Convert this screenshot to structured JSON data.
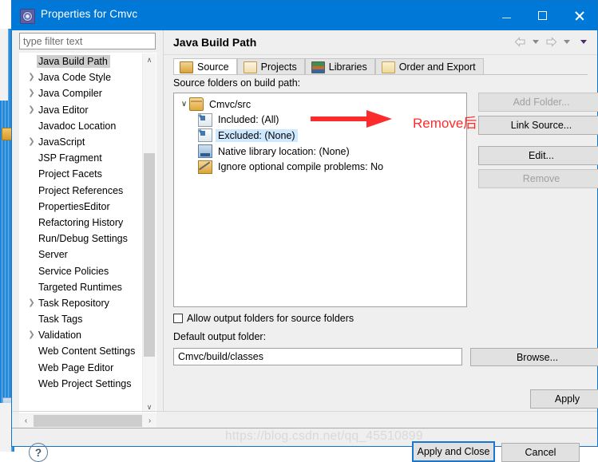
{
  "window": {
    "title": "Properties for Cmvc",
    "icon": "properties-gear-icon",
    "minimize_label": "—",
    "maximize_label": "□",
    "close_label": "✕"
  },
  "sidebar": {
    "filter": {
      "placeholder": "type filter text",
      "value": ""
    },
    "items": [
      {
        "label": "Java Build Path",
        "expandable": false,
        "selected": true
      },
      {
        "label": "Java Code Style",
        "expandable": true,
        "selected": false
      },
      {
        "label": "Java Compiler",
        "expandable": true,
        "selected": false
      },
      {
        "label": "Java Editor",
        "expandable": true,
        "selected": false
      },
      {
        "label": "Javadoc Location",
        "expandable": false,
        "selected": false
      },
      {
        "label": "JavaScript",
        "expandable": true,
        "selected": false
      },
      {
        "label": "JSP Fragment",
        "expandable": false,
        "selected": false
      },
      {
        "label": "Project Facets",
        "expandable": false,
        "selected": false
      },
      {
        "label": "Project References",
        "expandable": false,
        "selected": false
      },
      {
        "label": "PropertiesEditor",
        "expandable": false,
        "selected": false
      },
      {
        "label": "Refactoring History",
        "expandable": false,
        "selected": false
      },
      {
        "label": "Run/Debug Settings",
        "expandable": false,
        "selected": false
      },
      {
        "label": "Server",
        "expandable": false,
        "selected": false
      },
      {
        "label": "Service Policies",
        "expandable": false,
        "selected": false
      },
      {
        "label": "Targeted Runtimes",
        "expandable": false,
        "selected": false
      },
      {
        "label": "Task Repository",
        "expandable": true,
        "selected": false
      },
      {
        "label": "Task Tags",
        "expandable": false,
        "selected": false
      },
      {
        "label": "Validation",
        "expandable": true,
        "selected": false
      },
      {
        "label": "Web Content Settings",
        "expandable": false,
        "selected": false
      },
      {
        "label": "Web Page Editor",
        "expandable": false,
        "selected": false
      },
      {
        "label": "Web Project Settings",
        "expandable": false,
        "selected": false
      }
    ],
    "scroll_up": "∧",
    "scroll_down": "∨",
    "scroll_left": "‹",
    "scroll_right": "›"
  },
  "page": {
    "title": "Java Build Path",
    "nav_back": "back-arrow",
    "nav_forward": "forward-arrow",
    "nav_menu": "view-menu"
  },
  "tabs": [
    {
      "label": "Source",
      "icon": "source-folder-icon",
      "active": true
    },
    {
      "label": "Projects",
      "icon": "projects-folder-icon",
      "active": false
    },
    {
      "label": "Libraries",
      "icon": "libraries-books-icon",
      "active": false
    },
    {
      "label": "Order and Export",
      "icon": "order-export-icon",
      "active": false
    }
  ],
  "source_tab": {
    "list_label": "Source folders on build path:",
    "tree": [
      {
        "label": "Cmvc/src",
        "icon": "source-folder-icon",
        "level": 0,
        "twisty": "∨",
        "selected": false
      },
      {
        "label": "Included: (All)",
        "icon": "include-filter-icon",
        "level": 1,
        "twisty": "",
        "selected": false
      },
      {
        "label": "Excluded: (None)",
        "icon": "exclude-filter-icon",
        "level": 1,
        "twisty": "",
        "selected": true
      },
      {
        "label": "Native library location: (None)",
        "icon": "native-library-icon",
        "level": 1,
        "twisty": "",
        "selected": false
      },
      {
        "label": "Ignore optional compile problems: No",
        "icon": "ignore-problems-icon",
        "level": 1,
        "twisty": "",
        "selected": false
      }
    ],
    "buttons": [
      {
        "label": "Add Folder...",
        "enabled": false
      },
      {
        "label": "Link Source...",
        "enabled": true
      },
      {
        "label": "Edit...",
        "enabled": true
      },
      {
        "label": "Remove",
        "enabled": false
      }
    ],
    "allow_output_label": "Allow output folders for source folders",
    "allow_output_checked": false,
    "default_output_label": "Default output folder:",
    "default_output_value": "Cmvc/build/classes",
    "browse_label": "Browse..."
  },
  "annotation": {
    "text": "Remove后",
    "color": "#fc2c2c",
    "shape": "red-right-arrow"
  },
  "footer": {
    "apply_label": "Apply",
    "apply_and_close_label": "Apply and Close",
    "cancel_label": "Cancel",
    "help_label": "?"
  },
  "watermark": {
    "text": "https://blog.csdn.net/qq_45510899"
  }
}
